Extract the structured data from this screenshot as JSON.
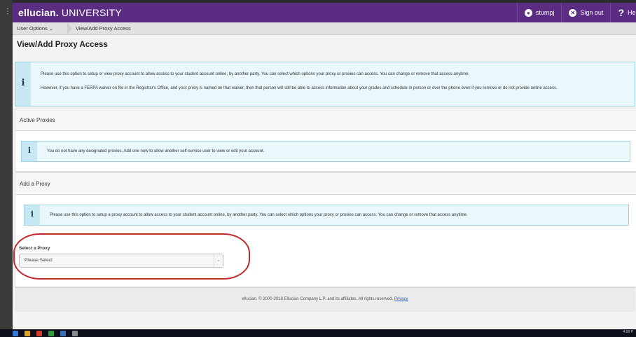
{
  "header": {
    "brand_prefix": "ellucian.",
    "brand_suffix": "UNIVERSITY",
    "user_name": "stumpj",
    "sign_out": "Sign out",
    "help": "Help",
    "help_glyph": "?"
  },
  "breadcrumb": {
    "user_options": "User Options ⌄",
    "current": "View/Add Proxy Access"
  },
  "page_title": "View/Add Proxy Access",
  "info_glyph": "i",
  "intro": {
    "p1": "Please use this option to setup or view proxy account to allow access to your student account online, by another party. You can select which options your proxy or proxies can access. You can change or remove that access anytime.",
    "p2": "However, if you have a FERPA waiver on file in the Registrar's Office, and your proxy is named on that waiver, then that person will still be able to access information about your grades and schedule in person or over the phone even if you remove or do not provide online access."
  },
  "active_proxies": {
    "heading": "Active Proxies",
    "message": "You do not have any designated proxies. Add one now to allow another self-service user to view or edit your account."
  },
  "add_proxy": {
    "heading": "Add a Proxy",
    "message": "Please use this option to setup a proxy account to allow access to your student account online, by another party. You can select which options your proxy or proxies can access. You can change or remove that access anytime.",
    "select_label": "Select a Proxy",
    "select_value": "Please Select"
  },
  "footer": {
    "text": "ellucian. © 2000-2018 Ellucian Company L.P. and its affiliates. All rights reserved.",
    "privacy": "Privacy"
  },
  "taskbar": {
    "time": "4:00 P"
  },
  "colors": {
    "header_purple": "#5b2d82",
    "info_bg": "#eaf7fb",
    "annotation_red": "#c12a2a"
  },
  "icons": [
    "user-circle-icon",
    "close-circle-icon",
    "help-icon",
    "info-icon",
    "chevron-down-icon",
    "windows-start-icon"
  ]
}
